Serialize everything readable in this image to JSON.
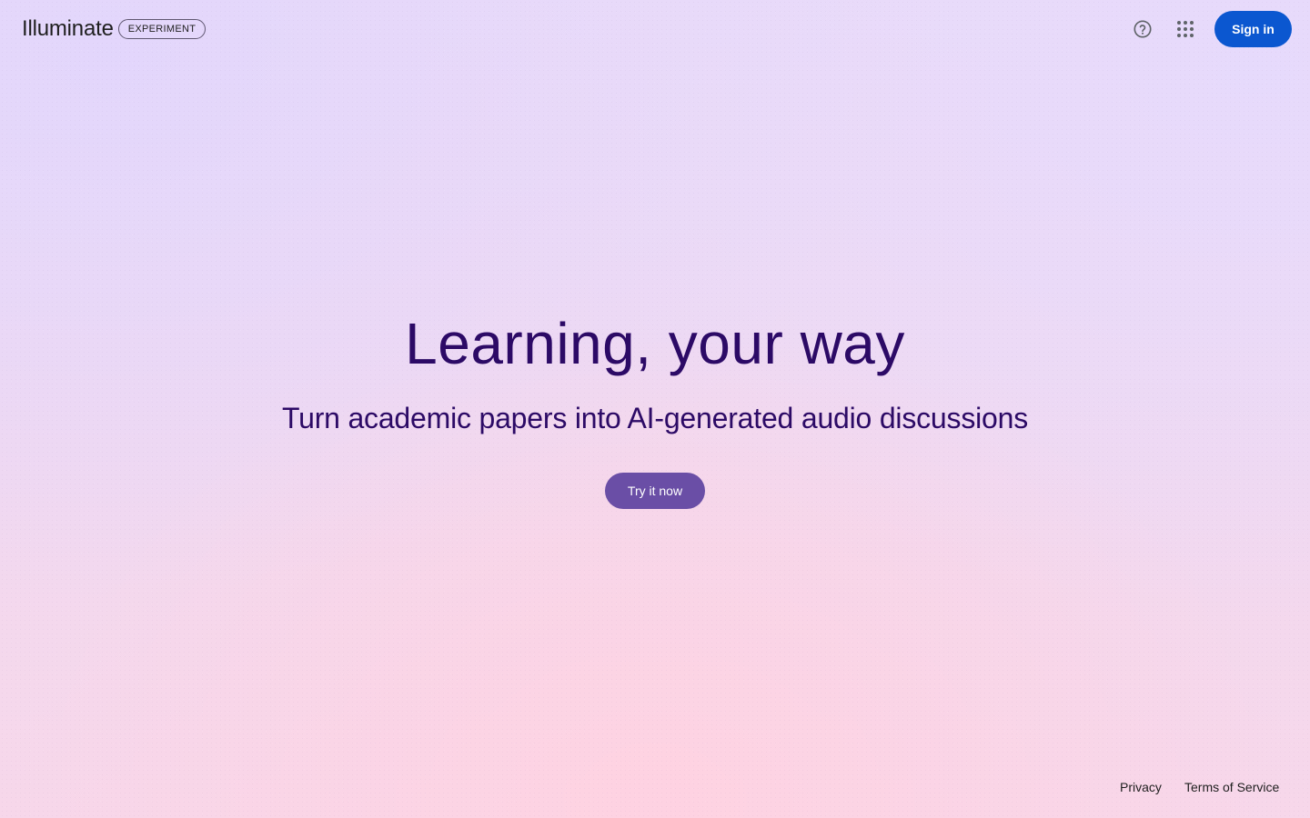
{
  "header": {
    "brand_name": "Illuminate",
    "badge": "EXPERIMENT",
    "help_icon": "help-circle-icon",
    "apps_icon": "apps-grid-icon",
    "signin_label": "Sign in"
  },
  "hero": {
    "title": "Learning, your way",
    "subtitle": "Turn academic papers into AI-generated audio discussions",
    "cta_label": "Try it now"
  },
  "footer": {
    "privacy_label": "Privacy",
    "terms_label": "Terms of Service"
  },
  "colors": {
    "signin_button": "#0b57d0",
    "cta_button": "#6a4ea6",
    "heading_text": "#2c0a66"
  }
}
